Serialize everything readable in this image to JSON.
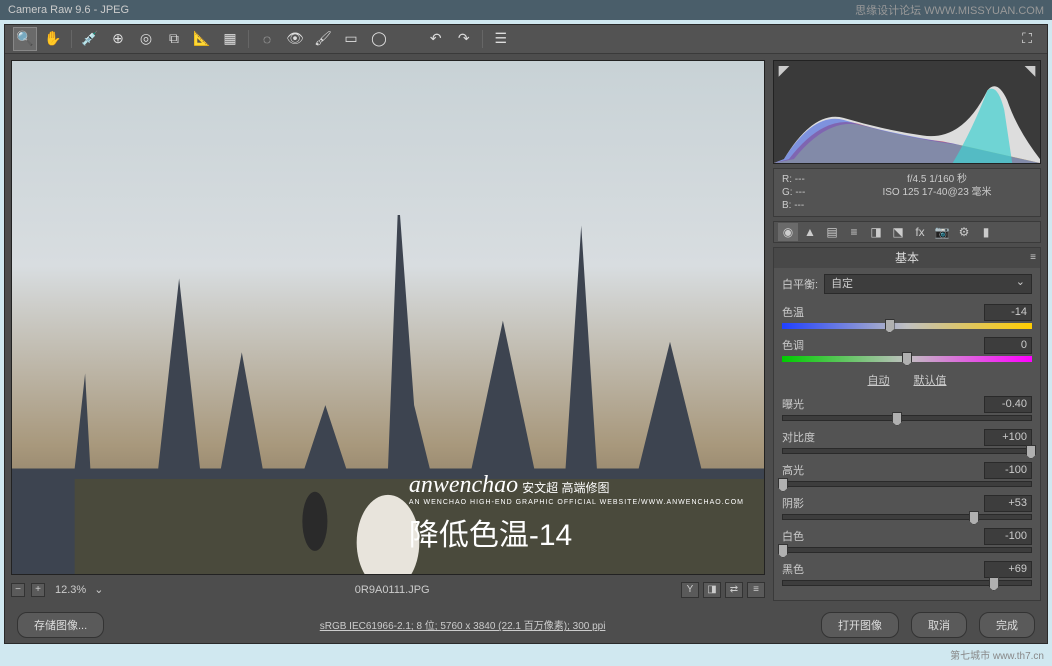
{
  "titlebar": {
    "app": "Camera Raw 9.6",
    "format": "JPEG",
    "right": "思缘设计论坛  WWW.MISSYUAN.COM"
  },
  "preview": {
    "zoom": "12.3%",
    "filename": "0R9A0111.JPG",
    "overlay_brand": "anwenchao",
    "overlay_cn": "安文超 高端修图",
    "overlay_sub": "AN WENCHAO HIGH-END GRAPHIC OFFICIAL WEBSITE/WWW.ANWENCHAO.COM",
    "overlay_main": "降低色温-14"
  },
  "info": {
    "r": "R:  ---",
    "g": "G:  ---",
    "b": "B:  ---",
    "aperture_shutter": "f/4.5  1/160 秒",
    "iso_lens": "ISO 125  17-40@23 毫米"
  },
  "panel": {
    "title": "基本",
    "wb_label": "白平衡:",
    "wb_value": "自定",
    "temp_label": "色温",
    "temp_value": "-14",
    "tint_label": "色调",
    "tint_value": "0",
    "auto": "自动",
    "default": "默认值",
    "sliders": [
      {
        "label": "曝光",
        "value": "-0.40",
        "pos": 46
      },
      {
        "label": "对比度",
        "value": "+100",
        "pos": 100
      },
      {
        "label": "高光",
        "value": "-100",
        "pos": 0
      },
      {
        "label": "阴影",
        "value": "+53",
        "pos": 77
      },
      {
        "label": "白色",
        "value": "-100",
        "pos": 0
      },
      {
        "label": "黑色",
        "value": "+69",
        "pos": 85
      }
    ]
  },
  "bottom": {
    "save": "存储图像...",
    "meta": "sRGB IEC61966-2.1; 8 位; 5760 x 3840 (22.1 百万像素); 300 ppi",
    "open": "打开图像",
    "cancel": "取消",
    "done": "完成"
  },
  "watermark": "第七城市 www.th7.cn"
}
